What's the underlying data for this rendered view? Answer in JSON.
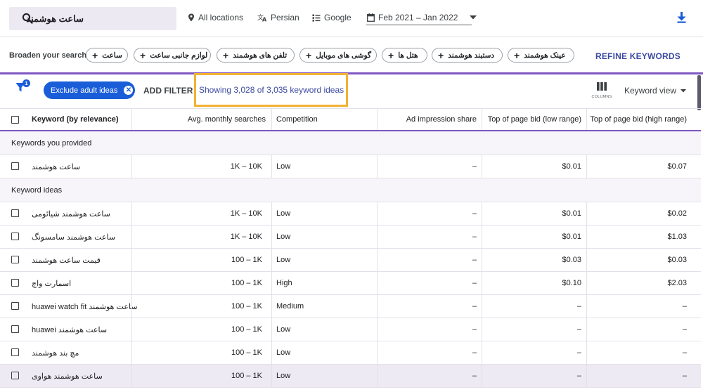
{
  "search": {
    "value": "ساعت هوشمند"
  },
  "toolbar": {
    "location": "All locations",
    "language": "Persian",
    "network": "Google",
    "date_range": "Feb 2021 – Jan 2022"
  },
  "broaden": {
    "label": "Broaden your search:",
    "chips": [
      "ساعت",
      "لوازم جانبی ساعت",
      "تلفن های هوشمند",
      "گوشی های موبایل",
      "هتل ها",
      "دستبند هوشمند",
      "عینک هوشمند"
    ],
    "refine_label": "REFINE KEYWORDS"
  },
  "filter": {
    "badge_count": "1",
    "exclude_chip": "Exclude adult ideas",
    "add_filter": "ADD FILTER",
    "showing": "Showing 3,028 of 3,035 keyword ideas",
    "columns_label": "COLUMNS",
    "view_label": "Keyword view"
  },
  "table": {
    "headers": [
      "Keyword (by relevance)",
      "Avg. monthly searches",
      "Competition",
      "Ad impression share",
      "Top of page bid (low range)",
      "Top of page bid (high range)"
    ],
    "section_provided": "Keywords you provided",
    "provided_rows": [
      {
        "keyword": "ساعت هوشمند",
        "searches": "1K – 10K",
        "competition": "Low",
        "share": "–",
        "bid_low": "$0.01",
        "bid_high": "$0.07"
      }
    ],
    "section_ideas": "Keyword ideas",
    "idea_rows": [
      {
        "keyword": "ساعت هوشمند شیائومی",
        "searches": "1K – 10K",
        "competition": "Low",
        "share": "–",
        "bid_low": "$0.01",
        "bid_high": "$0.02"
      },
      {
        "keyword": "ساعت هوشمند سامسونگ",
        "searches": "1K – 10K",
        "competition": "Low",
        "share": "–",
        "bid_low": "$0.01",
        "bid_high": "$1.03"
      },
      {
        "keyword": "قیمت ساعت هوشمند",
        "searches": "100 – 1K",
        "competition": "Low",
        "share": "–",
        "bid_low": "$0.03",
        "bid_high": "$0.03"
      },
      {
        "keyword": "اسمارت واچ",
        "searches": "100 – 1K",
        "competition": "High",
        "share": "–",
        "bid_low": "$0.10",
        "bid_high": "$2.03"
      },
      {
        "keyword": "ساعت هوشمند huawei watch fit",
        "searches": "100 – 1K",
        "competition": "Medium",
        "share": "–",
        "bid_low": "–",
        "bid_high": "–"
      },
      {
        "keyword": "ساعت هوشمند huawei",
        "searches": "100 – 1K",
        "competition": "Low",
        "share": "–",
        "bid_low": "–",
        "bid_high": "–"
      },
      {
        "keyword": "مچ بند هوشمند",
        "searches": "100 – 1K",
        "competition": "Low",
        "share": "–",
        "bid_low": "–",
        "bid_high": "–"
      },
      {
        "keyword": "ساعت هوشمند هواوی",
        "searches": "100 – 1K",
        "competition": "Low",
        "share": "–",
        "bid_low": "–",
        "bid_high": "–"
      }
    ]
  }
}
